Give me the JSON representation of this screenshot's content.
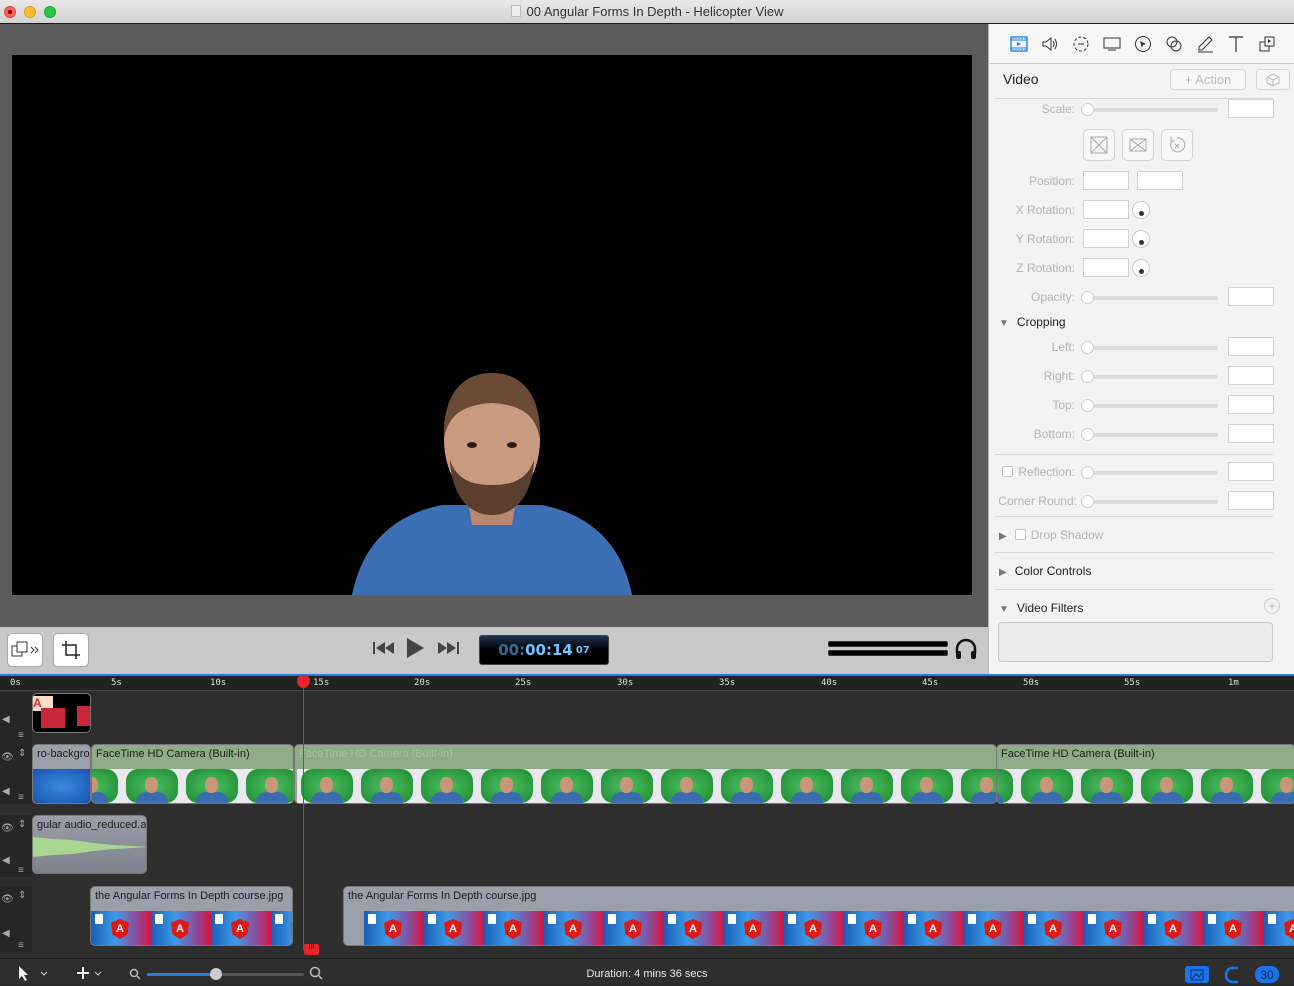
{
  "window": {
    "title": "00 Angular Forms In Depth - Helicopter View",
    "buttons": [
      "close",
      "minimize",
      "maximize"
    ]
  },
  "player": {
    "timecode": {
      "hours_dim": "00:",
      "time": "00:14",
      "frames": "07"
    },
    "transport": {
      "rewind_icon": "skip-back-icon",
      "play_icon": "play-icon",
      "forward_icon": "skip-forward-icon"
    },
    "left_buttons": [
      "canvas-options-icon",
      "crop-icon"
    ],
    "audio_icon": "headphones-icon"
  },
  "inspector": {
    "tabs": [
      "video-properties",
      "audio-properties",
      "screen-recording",
      "metadata-display",
      "cursor-properties",
      "annotations",
      "pencil-annotations",
      "text",
      "media-library"
    ],
    "header": "Video",
    "action_label": "+ Action",
    "fields": {
      "scale": "Scale:",
      "position": "Position:",
      "x_rotation": "X Rotation:",
      "y_rotation": "Y Rotation:",
      "z_rotation": "Z Rotation:",
      "opacity": "Opacity:"
    },
    "cropping": {
      "title": "Cropping",
      "left": "Left:",
      "right": "Right:",
      "top": "Top:",
      "bottom": "Bottom:"
    },
    "reflection": "Reflection:",
    "corner_round": "Corner Round:",
    "drop_shadow": "Drop Shadow",
    "color_controls": "Color Controls",
    "video_filters": "Video Filters"
  },
  "timeline": {
    "ruler_ticks": [
      "0s",
      "5s",
      "10s",
      "15s",
      "20s",
      "25s",
      "30s",
      "35s",
      "40s",
      "45s",
      "50s",
      "55s",
      "1m"
    ],
    "playhead_time": "14.07s",
    "tracks": [
      {
        "clips": [
          {
            "title": ""
          }
        ]
      },
      {
        "clips": [
          {
            "title": "ro-backgrou"
          },
          {
            "title": "FaceTime HD Camera (Built-in)"
          },
          {
            "title": "FaceTime HD Camera (Built-in)"
          },
          {
            "title": "FaceTime HD Camera (Built-in)"
          }
        ]
      },
      {
        "clips": [
          {
            "title": "gular audio_reduced.ai"
          }
        ]
      },
      {
        "clips": [
          {
            "title": "the Angular Forms In Depth course.jpg"
          },
          {
            "title": "the Angular Forms In Depth course.jpg"
          }
        ]
      }
    ]
  },
  "bottombar": {
    "duration": "Duration: 4 mins 36 secs",
    "zoom_level": 0.44,
    "fps": "30"
  }
}
